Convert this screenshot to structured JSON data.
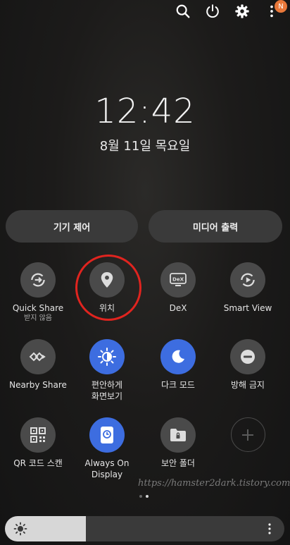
{
  "header": {
    "icons": [
      "search-icon",
      "power-icon",
      "settings-gear-icon",
      "more-vertical-icon"
    ],
    "notification_badge": "N"
  },
  "lockscreen": {
    "time": "12:42",
    "date": "8월 11일 목요일"
  },
  "buttons": {
    "device_control": "기기 제어",
    "media_output": "미디어 출력"
  },
  "tiles": [
    {
      "label": "Quick Share",
      "sub": "받지 않음",
      "icon": "quick-share-icon",
      "active": false
    },
    {
      "label": "위치",
      "sub": "",
      "icon": "location-pin-icon",
      "active": false
    },
    {
      "label": "DeX",
      "sub": "",
      "icon": "dex-icon",
      "active": false
    },
    {
      "label": "Smart View",
      "sub": "",
      "icon": "smart-view-icon",
      "active": false
    },
    {
      "label": "Nearby Share",
      "sub": "",
      "icon": "nearby-share-icon",
      "active": false
    },
    {
      "label": "편안하게\n화면보기",
      "sub": "",
      "icon": "eye-comfort-icon",
      "active": true
    },
    {
      "label": "다크 모드",
      "sub": "",
      "icon": "dark-mode-moon-icon",
      "active": true
    },
    {
      "label": "방해 금지",
      "sub": "",
      "icon": "do-not-disturb-icon",
      "active": false
    },
    {
      "label": "QR 코드 스캔",
      "sub": "",
      "icon": "qr-code-icon",
      "active": false
    },
    {
      "label": "Always On\nDisplay",
      "sub": "",
      "icon": "always-on-display-icon",
      "active": true
    },
    {
      "label": "보안 폴더",
      "sub": "",
      "icon": "secure-folder-icon",
      "active": false
    },
    {
      "label": "",
      "sub": "",
      "icon": "add-icon",
      "active": false
    }
  ],
  "watermark": "https://hamster2dark.tistory.com",
  "pager": {
    "pages": 2,
    "current": 2
  },
  "brightness": {
    "level": 0.29
  },
  "colors": {
    "accent": "#3d6de0",
    "highlight": "#e0241f",
    "badge": "#e8783a"
  }
}
